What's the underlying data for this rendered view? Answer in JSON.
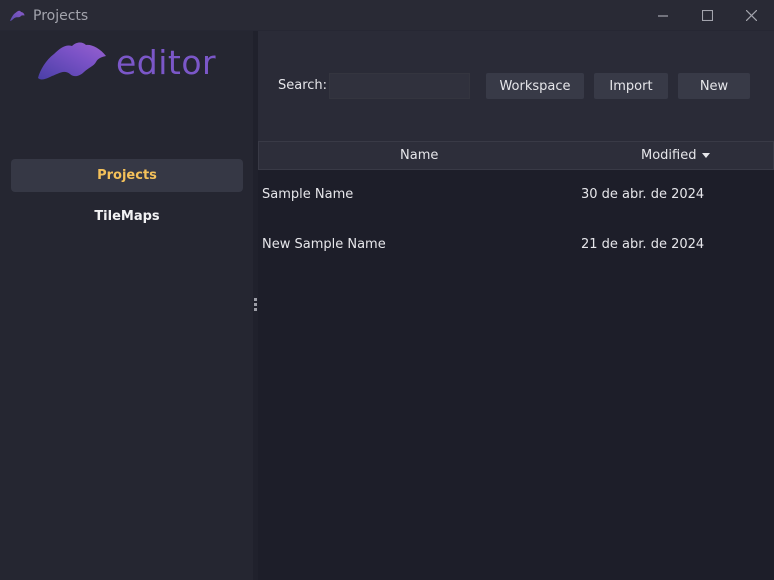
{
  "window": {
    "title": "Projects",
    "controls": [
      "minimize-icon",
      "maximize-icon",
      "close-icon"
    ]
  },
  "sidebar": {
    "logo_text": "editor",
    "items": [
      {
        "label": "Projects",
        "active": true
      },
      {
        "label": "TileMaps",
        "active": false
      }
    ]
  },
  "toolbar": {
    "search_label": "Search:",
    "search_value": "",
    "buttons": [
      "Workspace",
      "Import",
      "New"
    ]
  },
  "table": {
    "columns": [
      "Name",
      "Modified"
    ],
    "sort": {
      "column": "Modified",
      "direction": "descending"
    },
    "rows": [
      {
        "name": "Sample Name",
        "modified": "30 de abr. de 2024"
      },
      {
        "name": "New Sample Name",
        "modified": "21 de abr. de 2024"
      }
    ]
  },
  "colors": {
    "accent": "#f4c15a",
    "brand": "#7b57c8",
    "background": "#1d1e29"
  }
}
